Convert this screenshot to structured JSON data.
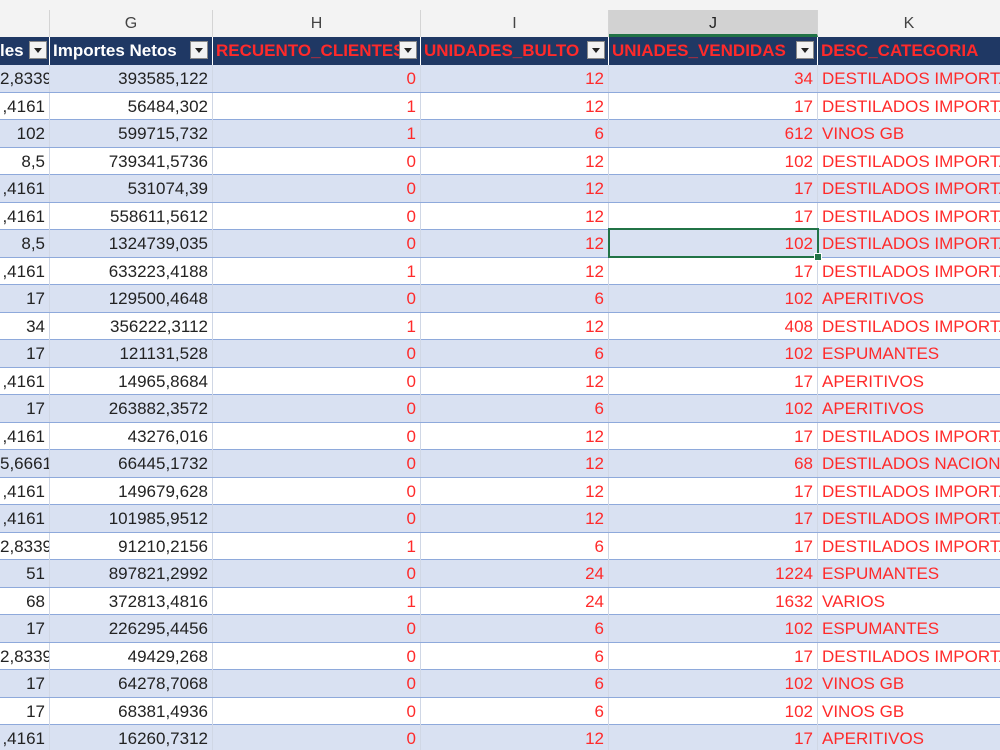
{
  "column_letters": [
    "G",
    "H",
    "I",
    "J",
    "K"
  ],
  "selected_column": "J",
  "headers": {
    "f_partial": "les",
    "g": "Importes Netos",
    "h": "RECUENTO_CLIENTES",
    "i": "UNIDADES_BULTO",
    "j": "UNIADES_VENDIDAS",
    "k": "DESC_CATEGORIA"
  },
  "rows": [
    {
      "f": "2,8339",
      "g": "393585,122",
      "h": "0",
      "i": "12",
      "j": "34",
      "k": "DESTILADOS IMPORTA"
    },
    {
      "f": ",4161",
      "g": "56484,302",
      "h": "1",
      "i": "12",
      "j": "17",
      "k": "DESTILADOS IMPORTA"
    },
    {
      "f": "102",
      "g": "599715,732",
      "h": "1",
      "i": "6",
      "j": "612",
      "k": "VINOS GB"
    },
    {
      "f": "8,5",
      "g": "739341,5736",
      "h": "0",
      "i": "12",
      "j": "102",
      "k": "DESTILADOS IMPORTA"
    },
    {
      "f": ",4161",
      "g": "531074,39",
      "h": "0",
      "i": "12",
      "j": "17",
      "k": "DESTILADOS IMPORTA"
    },
    {
      "f": ",4161",
      "g": "558611,5612",
      "h": "0",
      "i": "12",
      "j": "17",
      "k": "DESTILADOS IMPORTA"
    },
    {
      "f": "8,5",
      "g": "1324739,035",
      "h": "0",
      "i": "12",
      "j": "102",
      "k": "DESTILADOS IMPORTA"
    },
    {
      "f": ",4161",
      "g": "633223,4188",
      "h": "1",
      "i": "12",
      "j": "17",
      "k": "DESTILADOS IMPORTA"
    },
    {
      "f": "17",
      "g": "129500,4648",
      "h": "0",
      "i": "6",
      "j": "102",
      "k": "APERITIVOS"
    },
    {
      "f": "34",
      "g": "356222,3112",
      "h": "1",
      "i": "12",
      "j": "408",
      "k": "DESTILADOS IMPORTA"
    },
    {
      "f": "17",
      "g": "121131,528",
      "h": "0",
      "i": "6",
      "j": "102",
      "k": "ESPUMANTES"
    },
    {
      "f": ",4161",
      "g": "14965,8684",
      "h": "0",
      "i": "12",
      "j": "17",
      "k": "APERITIVOS"
    },
    {
      "f": "17",
      "g": "263882,3572",
      "h": "0",
      "i": "6",
      "j": "102",
      "k": "APERITIVOS"
    },
    {
      "f": ",4161",
      "g": "43276,016",
      "h": "0",
      "i": "12",
      "j": "17",
      "k": "DESTILADOS IMPORTA"
    },
    {
      "f": "5,6661",
      "g": "66445,1732",
      "h": "0",
      "i": "12",
      "j": "68",
      "k": "DESTILADOS NACIONA"
    },
    {
      "f": ",4161",
      "g": "149679,628",
      "h": "0",
      "i": "12",
      "j": "17",
      "k": "DESTILADOS IMPORTA"
    },
    {
      "f": ",4161",
      "g": "101985,9512",
      "h": "0",
      "i": "12",
      "j": "17",
      "k": "DESTILADOS IMPORTA"
    },
    {
      "f": "2,8339",
      "g": "91210,2156",
      "h": "1",
      "i": "6",
      "j": "17",
      "k": "DESTILADOS IMPORTA"
    },
    {
      "f": "51",
      "g": "897821,2992",
      "h": "0",
      "i": "24",
      "j": "1224",
      "k": "ESPUMANTES"
    },
    {
      "f": "68",
      "g": "372813,4816",
      "h": "1",
      "i": "24",
      "j": "1632",
      "k": "VARIOS"
    },
    {
      "f": "17",
      "g": "226295,4456",
      "h": "0",
      "i": "6",
      "j": "102",
      "k": "ESPUMANTES"
    },
    {
      "f": "2,8339",
      "g": "49429,268",
      "h": "0",
      "i": "6",
      "j": "17",
      "k": "DESTILADOS IMPORTA"
    },
    {
      "f": "17",
      "g": "64278,7068",
      "h": "0",
      "i": "6",
      "j": "102",
      "k": "VINOS GB"
    },
    {
      "f": "17",
      "g": "68381,4936",
      "h": "0",
      "i": "6",
      "j": "102",
      "k": "VINOS GB"
    },
    {
      "f": ",4161",
      "g": "16260,7312",
      "h": "0",
      "i": "12",
      "j": "17",
      "k": "APERITIVOS"
    }
  ],
  "colors": {
    "header_bg": "#1f3864",
    "band": "#d9e1f2",
    "red_text": "#ff2a2a",
    "selection": "#217346"
  }
}
